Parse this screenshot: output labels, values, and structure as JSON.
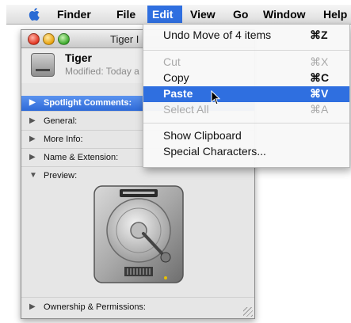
{
  "menubar": {
    "apple_icon": "apple-icon",
    "items": [
      "Finder",
      "File",
      "Edit",
      "View",
      "Go",
      "Window",
      "Help"
    ],
    "active": "Edit"
  },
  "edit_menu": {
    "items": [
      {
        "label": "Undo Move of 4 items",
        "shortcut": "⌘Z",
        "enabled": true
      },
      {
        "label": "Cut",
        "shortcut": "⌘X",
        "enabled": false
      },
      {
        "label": "Copy",
        "shortcut": "⌘C",
        "enabled": true
      },
      {
        "label": "Paste",
        "shortcut": "⌘V",
        "enabled": true,
        "highlighted": true
      },
      {
        "label": "Select All",
        "shortcut": "⌘A",
        "enabled": false
      },
      {
        "label": "Show Clipboard",
        "shortcut": "",
        "enabled": true
      },
      {
        "label": "Special Characters...",
        "shortcut": "",
        "enabled": true
      }
    ],
    "highlight_color": "#2f6fe0"
  },
  "info_window": {
    "title": "Tiger I",
    "item_name": "Tiger",
    "modified": "Modified: Today a",
    "sections": [
      {
        "label": "Spotlight Comments:",
        "expanded": false,
        "selected": true
      },
      {
        "label": "General:",
        "expanded": false
      },
      {
        "label": "More Info:",
        "expanded": false
      },
      {
        "label": "Name & Extension:",
        "expanded": false
      },
      {
        "label": "Preview:",
        "expanded": true
      },
      {
        "label": "Ownership & Permissions:",
        "expanded": false
      }
    ]
  }
}
